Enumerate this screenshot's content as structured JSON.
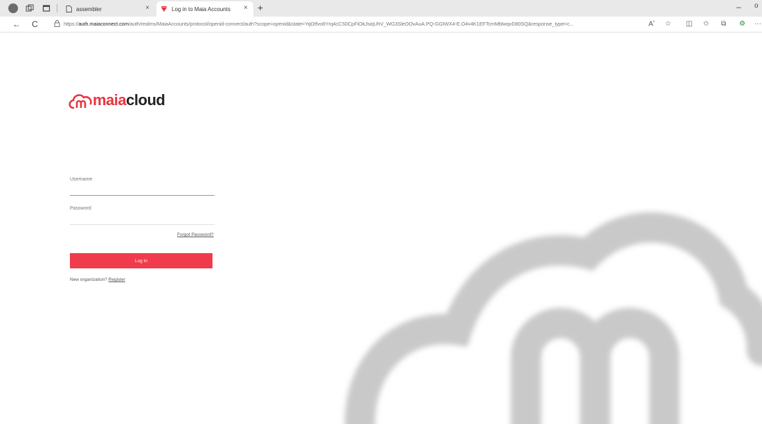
{
  "browser": {
    "tabs": [
      {
        "label": "assembler"
      },
      {
        "label": "Log in to Maia Accounts"
      }
    ],
    "url_prefix": "https://",
    "url_domain": "auth.maiaconnect.com",
    "url_rest": "/auth/realms/MaiaAccounts/protocol/openid-connect/auth?scope=openid&state=YqOtfvo8Yrq4cCS0CpFiOkJsiqUhV_WG3SleOOvAuA.PQ-GGIWX4-E.O4v4K1EFTcmMblwqxD80SQ&response_type=c..."
  },
  "logo": {
    "maia": "maia",
    "cloud": "cloud",
    "brand_color": "#e8333f"
  },
  "form": {
    "username_label": "Username",
    "username_value": "",
    "password_label": "Password",
    "password_value": "",
    "forgot_label": "Forgot Password?",
    "login_label": "Log In",
    "register_prefix": "New organization?",
    "register_label": "Register"
  },
  "icons": {
    "back": "←",
    "refresh": "C",
    "close": "×",
    "new_tab": "+",
    "lock": "⌂",
    "read_aloud": "A",
    "favorite": "☆",
    "split": "◫",
    "favorites": "✩",
    "collections": "⧉",
    "extensions": "⚙",
    "more": "···",
    "minimize": "–",
    "window_more": "o"
  }
}
